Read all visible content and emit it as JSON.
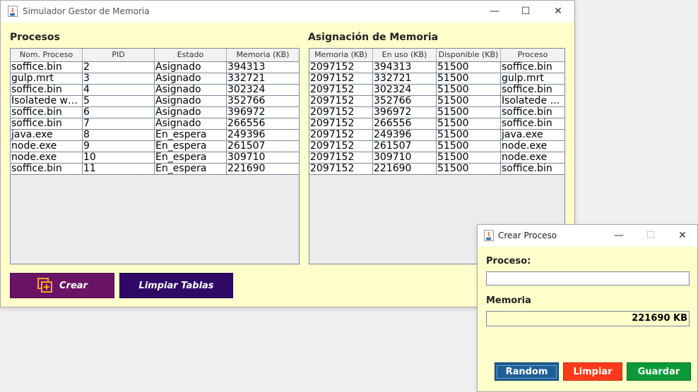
{
  "main_window": {
    "title": "Simulador Gestor de Memoria",
    "procesos_heading": "Procesos",
    "asignacion_heading": "Asignación de Memoria",
    "procesos_columns": [
      "Nom. Proceso",
      "PID",
      "Estado",
      "Memoria (KB)"
    ],
    "procesos_rows": [
      [
        "soffice.bin",
        "2",
        "Asignado",
        "394313"
      ],
      [
        "gulp.mrt",
        "3",
        "Asignado",
        "332721"
      ],
      [
        "soffice.bin",
        "4",
        "Asignado",
        "302324"
      ],
      [
        "Isolatede w…",
        "5",
        "Asignado",
        "352766"
      ],
      [
        "soffice.bin",
        "6",
        "Asignado",
        "396972"
      ],
      [
        "soffice.bin",
        "7",
        "Asignado",
        "266556"
      ],
      [
        "java.exe",
        "8",
        "En_espera",
        "249396"
      ],
      [
        "node.exe",
        "9",
        "En_espera",
        "261507"
      ],
      [
        "node.exe",
        "10",
        "En_espera",
        "309710"
      ],
      [
        "soffice.bin",
        "11",
        "En_espera",
        "221690"
      ]
    ],
    "asignacion_columns": [
      "Memoria (KB)",
      "En uso (KB)",
      "Disponible (KB)",
      "Proceso"
    ],
    "asignacion_rows": [
      [
        "2097152",
        "394313",
        "51500",
        "soffice.bin"
      ],
      [
        "2097152",
        "332721",
        "51500",
        "gulp.mrt"
      ],
      [
        "2097152",
        "302324",
        "51500",
        "soffice.bin"
      ],
      [
        "2097152",
        "352766",
        "51500",
        "Isolatede …"
      ],
      [
        "2097152",
        "396972",
        "51500",
        "soffice.bin"
      ],
      [
        "2097152",
        "266556",
        "51500",
        "soffice.bin"
      ],
      [
        "2097152",
        "249396",
        "51500",
        "java.exe"
      ],
      [
        "2097152",
        "261507",
        "51500",
        "node.exe"
      ],
      [
        "2097152",
        "309710",
        "51500",
        "node.exe"
      ],
      [
        "2097152",
        "221690",
        "51500",
        "soffice.bin"
      ]
    ],
    "crear_label": "Crear",
    "limpiar_tablas_label": "Limpiar Tablas",
    "minimize_glyph": "—",
    "maximize_glyph": "☐",
    "close_glyph": "✕"
  },
  "dialog": {
    "title": "Crear Proceso",
    "proceso_label": "Proceso:",
    "proceso_value": "",
    "memoria_label": "Memoria",
    "memoria_value": "221690 KB",
    "random_label": "Random",
    "limpiar_label": "Limpiar",
    "guardar_label": "Guardar",
    "minimize_glyph": "—",
    "maximize_glyph": "☐",
    "close_glyph": "✕"
  },
  "colors": {
    "client_bg": "#ffffcc",
    "crear_btn": "#6a1466",
    "limpiar_tablas_btn": "#2e0a66",
    "random_btn": "#1a5f98",
    "limpiar_btn": "#ff3a1a",
    "guardar_btn": "#0a9a3a"
  },
  "icons": {
    "app_icon": "java-cup-icon",
    "crear_icon": "add-copy-icon"
  }
}
